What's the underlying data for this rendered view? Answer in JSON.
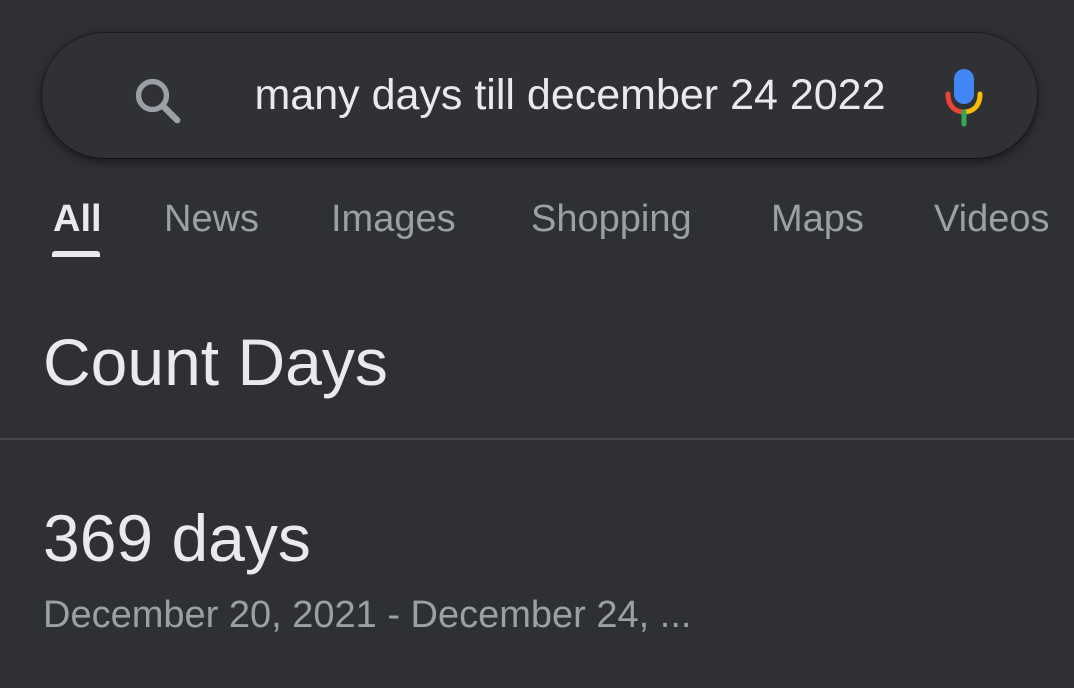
{
  "search": {
    "query": "many days till december 24 2022",
    "search_icon": "search-icon",
    "mic_icon": "microphone-icon"
  },
  "tabs": [
    {
      "label": "All",
      "active": true
    },
    {
      "label": "News",
      "active": false
    },
    {
      "label": "Images",
      "active": false
    },
    {
      "label": "Shopping",
      "active": false
    },
    {
      "label": "Maps",
      "active": false
    },
    {
      "label": "Videos",
      "active": false
    }
  ],
  "result": {
    "title": "Count Days",
    "value": "369 days",
    "range": "December 20, 2021 - December 24, ..."
  },
  "colors": {
    "background": "#303134",
    "primary_text": "#e8eaed",
    "secondary_text": "#9aa0a6",
    "mic_blue": "#4285f4",
    "mic_red": "#ea4335",
    "mic_yellow": "#fbbc05",
    "mic_green": "#34a853"
  }
}
